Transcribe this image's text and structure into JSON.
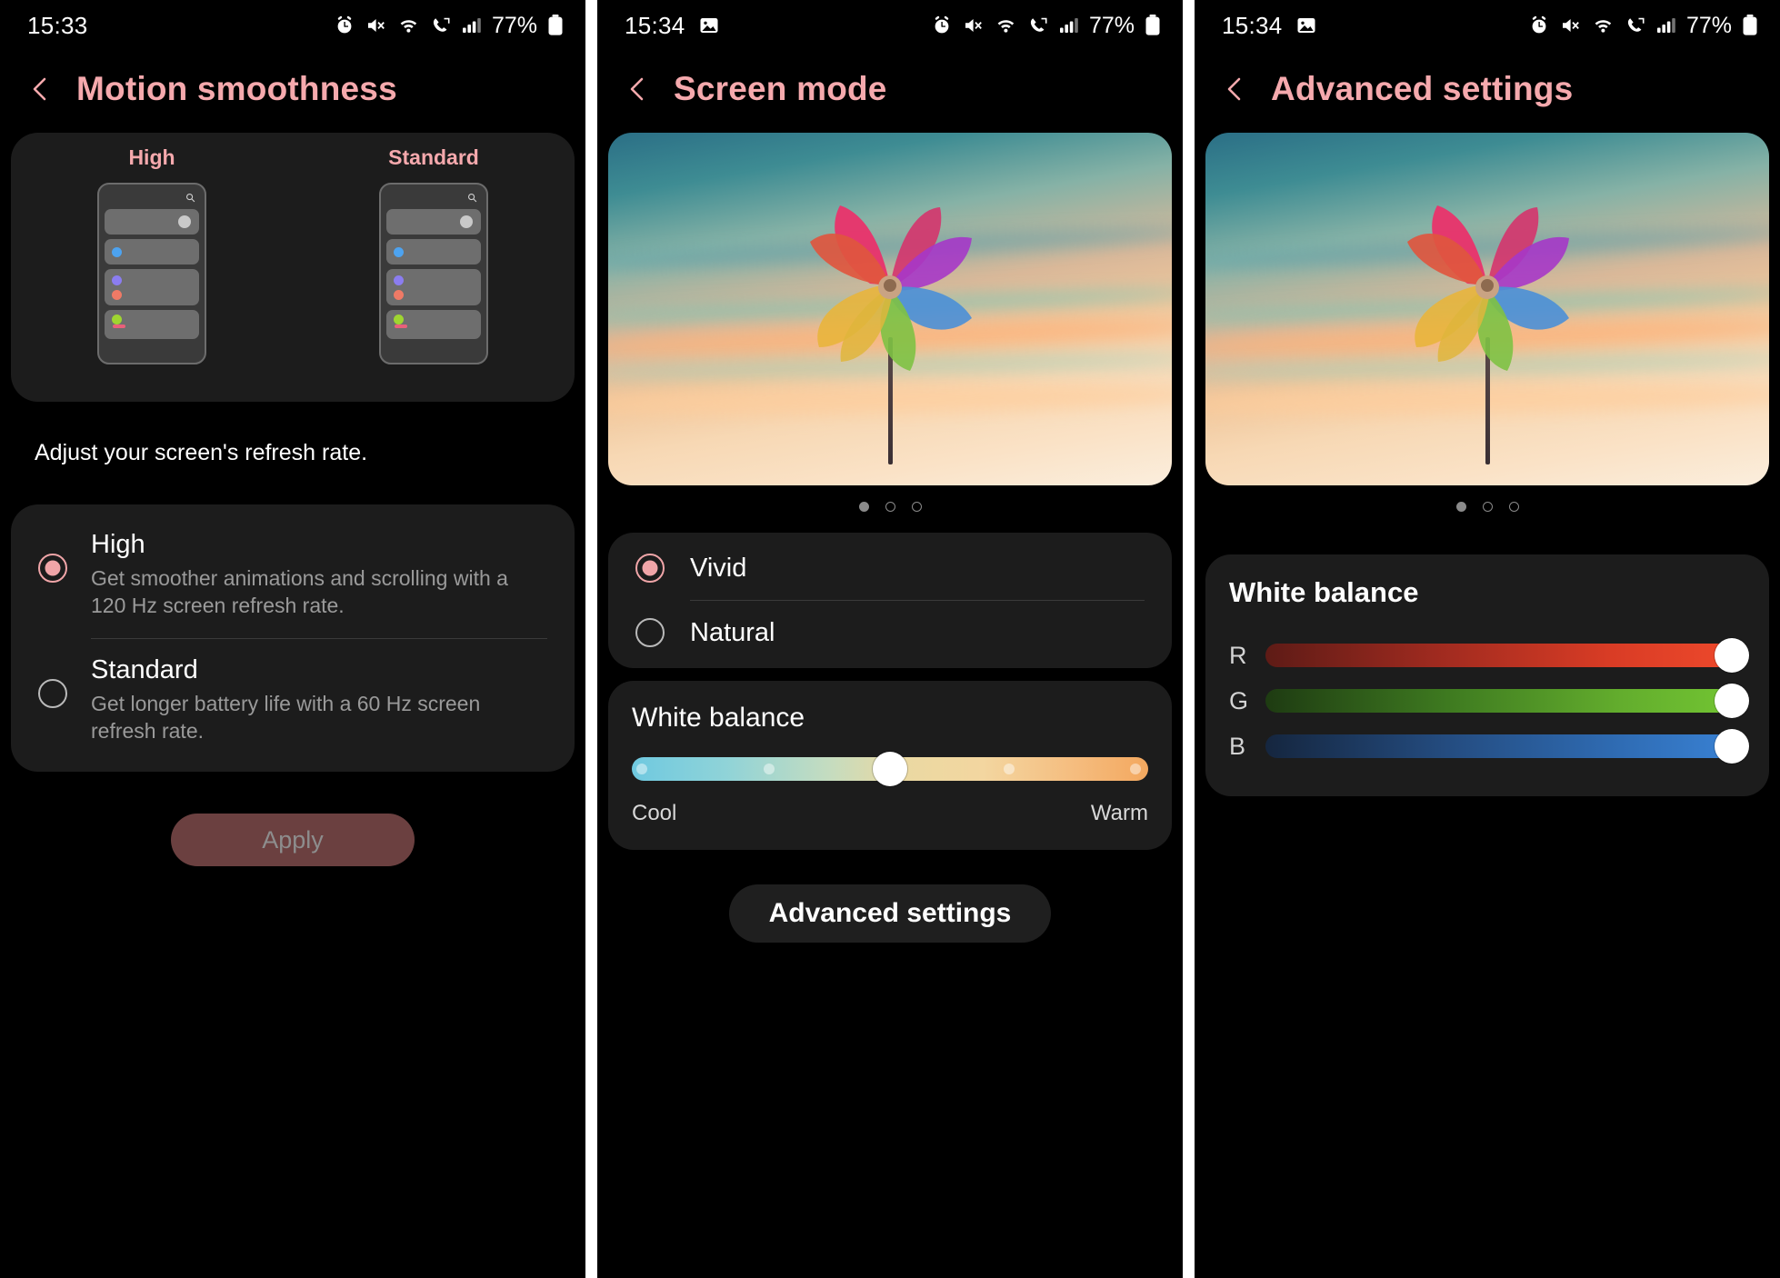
{
  "screens": [
    {
      "status": {
        "time": "15:33",
        "battery": "77%",
        "icons": [
          "alarm-icon",
          "mute-icon",
          "wifi-icon",
          "call-forward-icon",
          "signal-icon",
          "battery-icon"
        ]
      },
      "title": "Motion smoothness",
      "back_icon": "back-chevron-icon",
      "preview": {
        "columns": [
          {
            "label": "High"
          },
          {
            "label": "Standard"
          }
        ],
        "search_icon": "search-icon"
      },
      "hint": "Adjust your screen's refresh rate.",
      "options": [
        {
          "title": "High",
          "desc": "Get smoother animations and scrolling with a 120 Hz screen refresh rate.",
          "selected": true
        },
        {
          "title": "Standard",
          "desc": "Get longer battery life with a 60 Hz screen refresh rate.",
          "selected": false
        }
      ],
      "apply_label": "Apply"
    },
    {
      "status": {
        "time": "15:34",
        "battery": "77%",
        "icons": [
          "photo-icon",
          "alarm-icon",
          "mute-icon",
          "wifi-icon",
          "call-forward-icon",
          "signal-icon",
          "battery-icon"
        ]
      },
      "title": "Screen mode",
      "back_icon": "back-chevron-icon",
      "pager": {
        "count": 3,
        "active": 0
      },
      "modes": [
        {
          "label": "Vivid",
          "selected": true
        },
        {
          "label": "Natural",
          "selected": false
        }
      ],
      "white_balance": {
        "title": "White balance",
        "cool_label": "Cool",
        "warm_label": "Warm",
        "value_percent": 50
      },
      "advanced_label": "Advanced settings"
    },
    {
      "status": {
        "time": "15:34",
        "battery": "77%",
        "icons": [
          "photo-icon",
          "alarm-icon",
          "mute-icon",
          "wifi-icon",
          "call-forward-icon",
          "signal-icon",
          "battery-icon"
        ]
      },
      "title": "Advanced settings",
      "back_icon": "back-chevron-icon",
      "pager": {
        "count": 3,
        "active": 0
      },
      "white_balance": {
        "title": "White balance",
        "channels": [
          {
            "label": "R",
            "value_percent": 100,
            "color": "#ef4a2c"
          },
          {
            "label": "G",
            "value_percent": 100,
            "color": "#74c733"
          },
          {
            "label": "B",
            "value_percent": 100,
            "color": "#3a83d6"
          }
        ]
      }
    }
  ],
  "theme": {
    "accent_pink": "#f5a9ad",
    "card_bg": "#1c1c1c",
    "screen_bg": "#000000",
    "apply_bg": "#6b4040",
    "apply_text": "#8d8d8d"
  }
}
